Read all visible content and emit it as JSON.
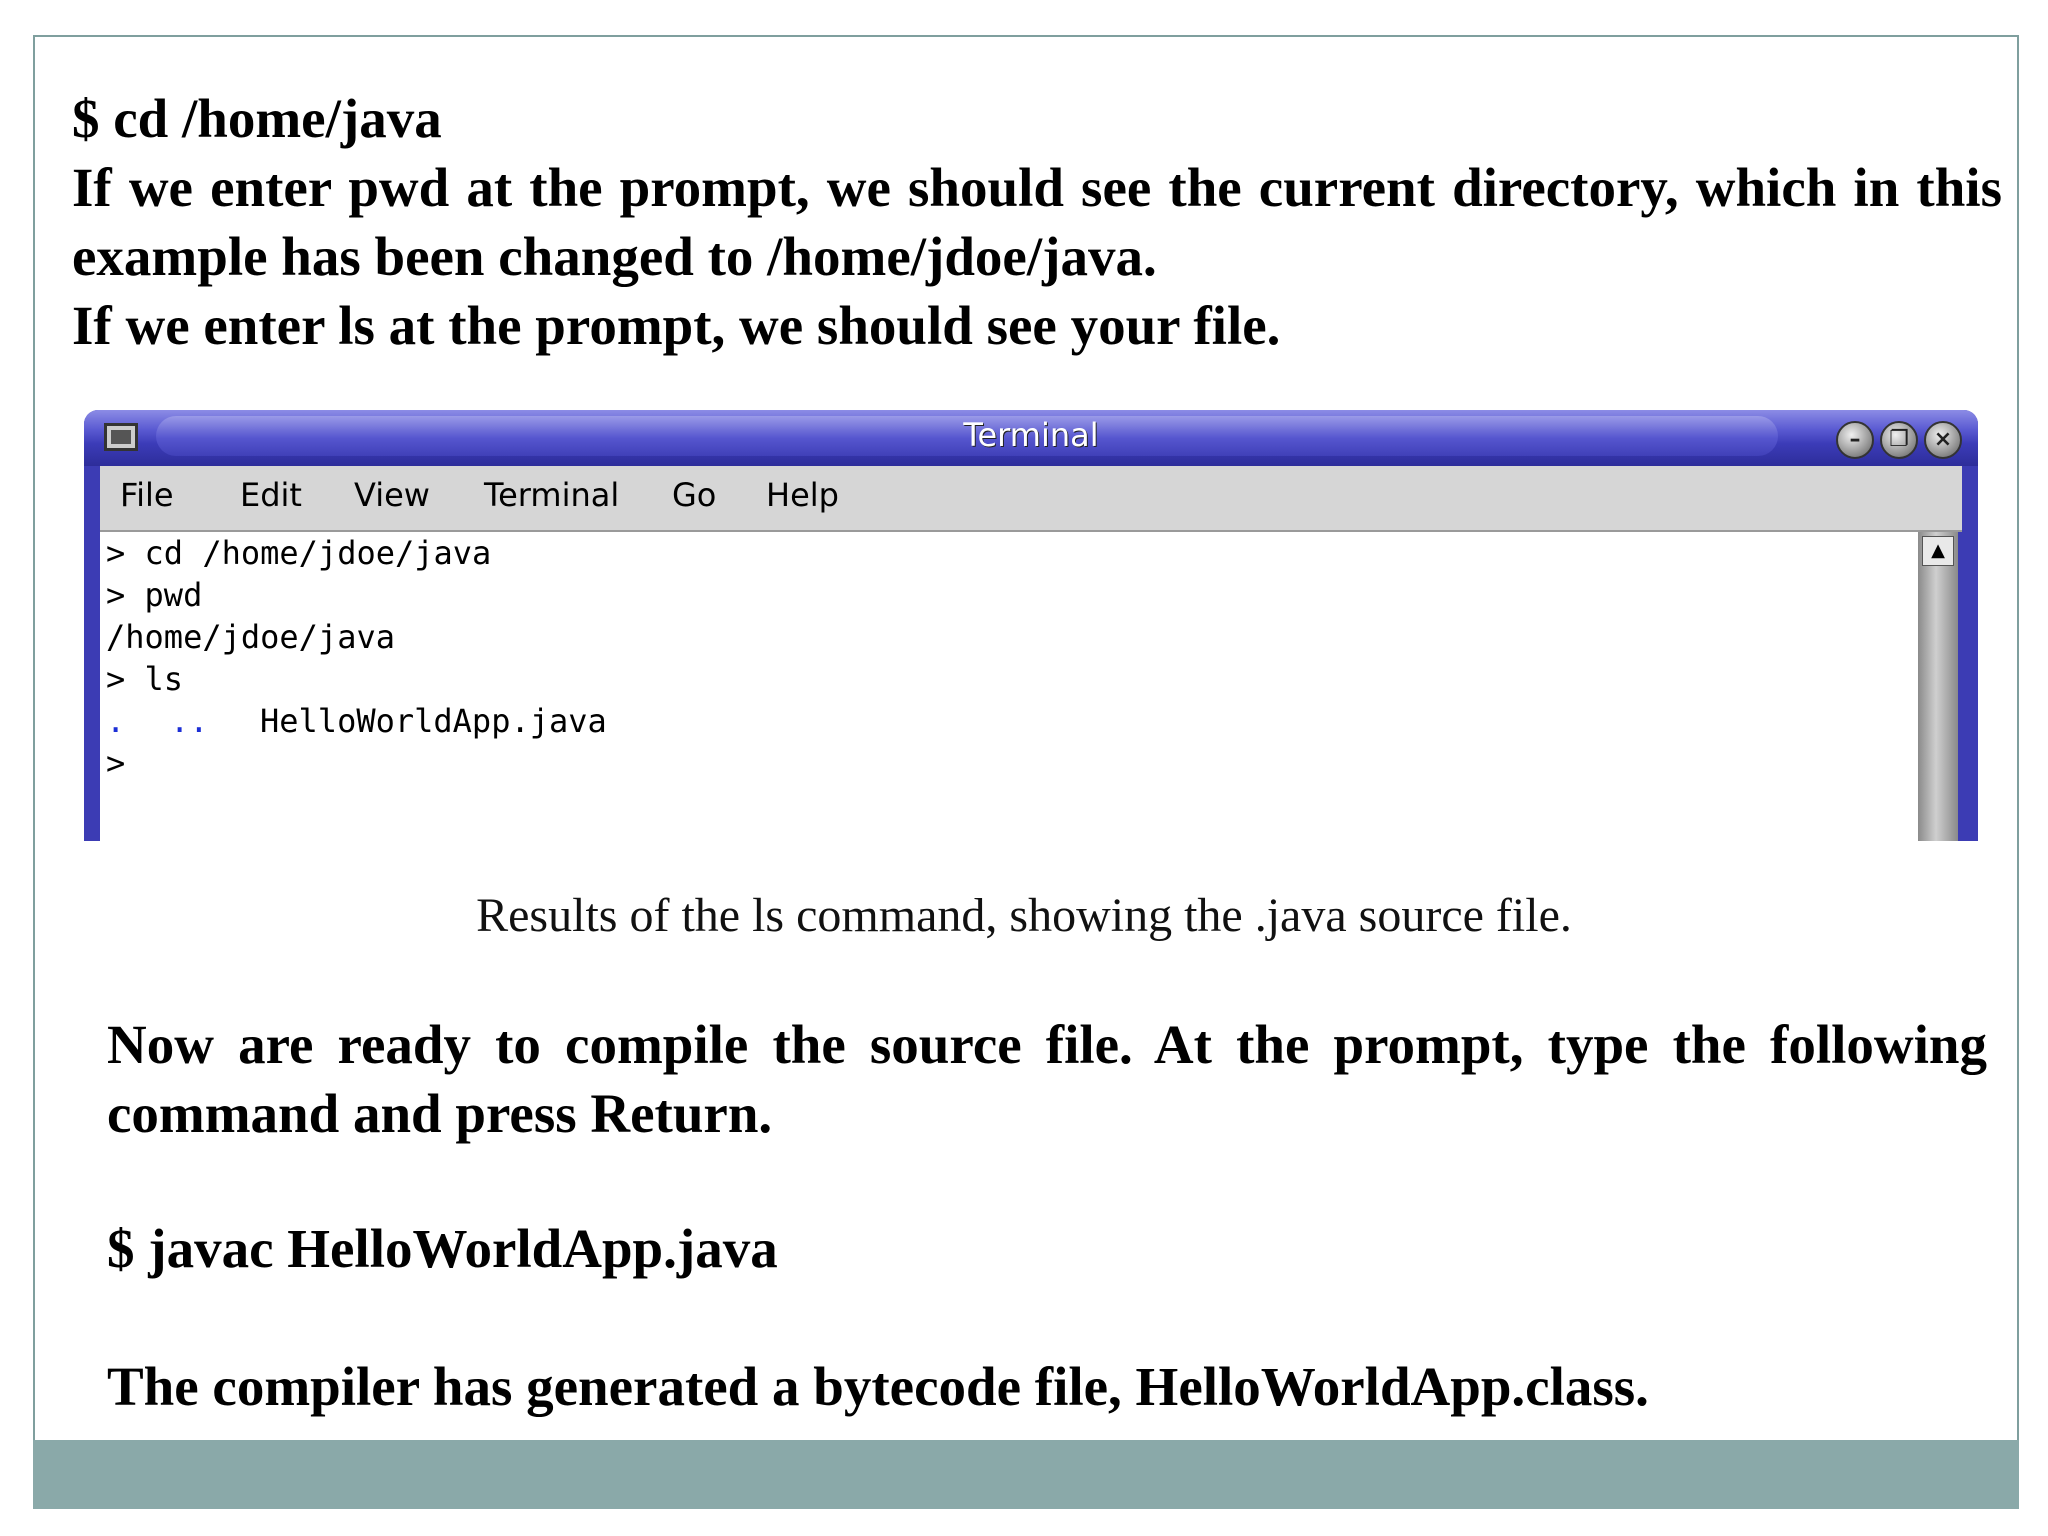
{
  "slide": {
    "paragraph1": "$ cd /home/java\nIf we enter pwd at the prompt, we should see the current directory, which in this example has been changed to /home/jdoe/java.\nIf we enter ls at the prompt, we should see your file.",
    "caption": "Results of the ls command, showing the .java source file.",
    "paragraph2": "Now are ready to compile the source file. At the prompt, type the following command and press Return.",
    "command": "$ javac HelloWorldApp.java",
    "paragraph3": "The compiler has generated a bytecode file, HelloWorldApp.class."
  },
  "terminal": {
    "title": "Terminal",
    "window_buttons": [
      "–",
      "❐",
      "×"
    ],
    "menu": [
      "File",
      "Edit",
      "View",
      "Terminal",
      "Go",
      "Help"
    ],
    "lines": [
      "> cd /home/jdoe/java",
      "> pwd",
      "/home/jdoe/java",
      "> ls",
      "HelloWorldApp.java",
      ">"
    ],
    "dir_entries": [
      ".",
      ".."
    ],
    "colors": {
      "frame": "#3c3cb4",
      "dir_entry": "#1c2fd6"
    }
  }
}
